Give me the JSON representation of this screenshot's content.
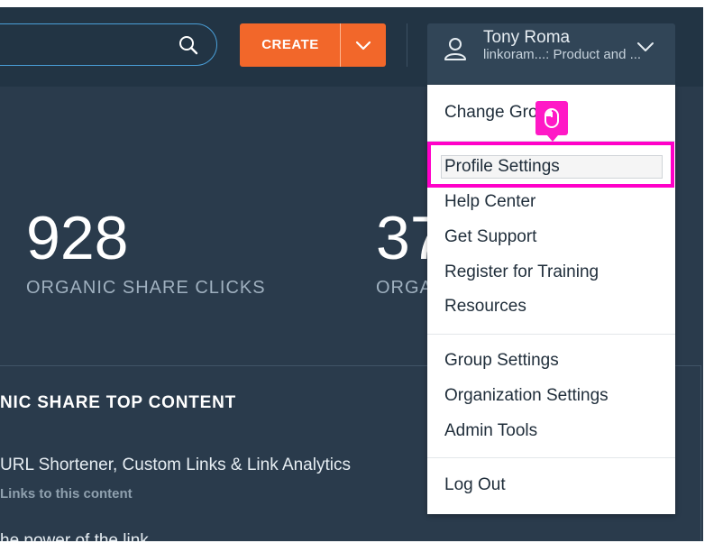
{
  "header": {
    "create_label": "CREATE",
    "user": {
      "name": "Tony Roma",
      "org": "linkoram...: Product and ..."
    }
  },
  "stats": [
    {
      "value": "928",
      "label": "ORGANIC SHARE CLICKS"
    },
    {
      "value": "37",
      "label": "ORGA"
    }
  ],
  "panel": {
    "title": "NIC SHARE TOP CONTENT",
    "item_title": "URL Shortener, Custom Links & Link Analytics",
    "item_sub": "Links to this content",
    "item2_title": "he power of the link"
  },
  "menu": {
    "items": [
      {
        "label": "Change Gro"
      },
      {
        "label": "Profile Settings"
      },
      {
        "label": "Help Center"
      },
      {
        "label": "Get Support"
      },
      {
        "label": "Register for Training"
      },
      {
        "label": "Resources"
      },
      {
        "label": "Group Settings"
      },
      {
        "label": "Organization Settings"
      },
      {
        "label": "Admin Tools"
      },
      {
        "label": "Log Out"
      }
    ]
  },
  "colors": {
    "background": "#2a3b4c",
    "topbar": "#223444",
    "accent": "#f2672a",
    "highlight": "#ff00c8"
  },
  "icons": [
    "search-icon",
    "chevron-down-icon",
    "user-icon",
    "mouse-icon"
  ]
}
